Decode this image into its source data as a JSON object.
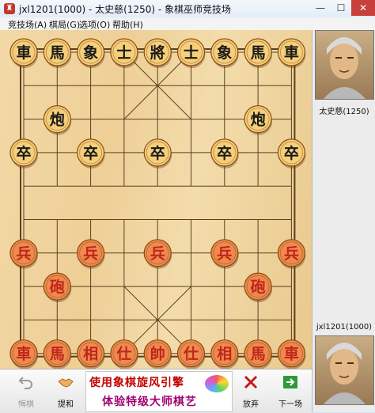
{
  "window": {
    "title": "jxl1201(1000) - 太史慈(1250) - 象棋巫师竞技场",
    "minimize_glyph": "—",
    "maximize_glyph": "☐",
    "close_glyph": "✕"
  },
  "menu": [
    {
      "label": "竞技场(A)"
    },
    {
      "label": "棋局(G)"
    },
    {
      "label": "选项(O)"
    },
    {
      "label": "帮助(H)"
    }
  ],
  "players": {
    "opponent": {
      "name": "太史慈(1250)"
    },
    "self": {
      "name": "jxl1201(1000)"
    }
  },
  "toolbar": {
    "undo_label": "悔棋",
    "draw_label": "提和",
    "resign_label": "放弃",
    "next_label": "下一场"
  },
  "ad": {
    "line1": "使用象棋旋风引擎",
    "line2": "体验特级大师棋艺"
  },
  "board_colors": {
    "black_piece_text": "#1a1a1a",
    "red_piece_text": "#c0261b",
    "black_piece_face": "#f5cf7a",
    "red_piece_face": "#ee8a4e",
    "line": "#5a4020"
  },
  "pieces": [
    {
      "col": 0,
      "row": 0,
      "side": "black",
      "label": "車",
      "name": "black-chariot"
    },
    {
      "col": 1,
      "row": 0,
      "side": "black",
      "label": "馬",
      "name": "black-horse"
    },
    {
      "col": 2,
      "row": 0,
      "side": "black",
      "label": "象",
      "name": "black-elephant"
    },
    {
      "col": 3,
      "row": 0,
      "side": "black",
      "label": "士",
      "name": "black-advisor"
    },
    {
      "col": 4,
      "row": 0,
      "side": "black",
      "label": "將",
      "name": "black-general"
    },
    {
      "col": 5,
      "row": 0,
      "side": "black",
      "label": "士",
      "name": "black-advisor"
    },
    {
      "col": 6,
      "row": 0,
      "side": "black",
      "label": "象",
      "name": "black-elephant"
    },
    {
      "col": 7,
      "row": 0,
      "side": "black",
      "label": "馬",
      "name": "black-horse"
    },
    {
      "col": 8,
      "row": 0,
      "side": "black",
      "label": "車",
      "name": "black-chariot"
    },
    {
      "col": 1,
      "row": 2,
      "side": "black",
      "label": "炮",
      "name": "black-cannon"
    },
    {
      "col": 7,
      "row": 2,
      "side": "black",
      "label": "炮",
      "name": "black-cannon"
    },
    {
      "col": 0,
      "row": 3,
      "side": "black",
      "label": "卒",
      "name": "black-soldier"
    },
    {
      "col": 2,
      "row": 3,
      "side": "black",
      "label": "卒",
      "name": "black-soldier"
    },
    {
      "col": 4,
      "row": 3,
      "side": "black",
      "label": "卒",
      "name": "black-soldier"
    },
    {
      "col": 6,
      "row": 3,
      "side": "black",
      "label": "卒",
      "name": "black-soldier"
    },
    {
      "col": 8,
      "row": 3,
      "side": "black",
      "label": "卒",
      "name": "black-soldier"
    },
    {
      "col": 0,
      "row": 6,
      "side": "red",
      "label": "兵",
      "name": "red-soldier"
    },
    {
      "col": 2,
      "row": 6,
      "side": "red",
      "label": "兵",
      "name": "red-soldier"
    },
    {
      "col": 4,
      "row": 6,
      "side": "red",
      "label": "兵",
      "name": "red-soldier"
    },
    {
      "col": 6,
      "row": 6,
      "side": "red",
      "label": "兵",
      "name": "red-soldier"
    },
    {
      "col": 8,
      "row": 6,
      "side": "red",
      "label": "兵",
      "name": "red-soldier"
    },
    {
      "col": 1,
      "row": 7,
      "side": "red",
      "label": "砲",
      "name": "red-cannon"
    },
    {
      "col": 7,
      "row": 7,
      "side": "red",
      "label": "砲",
      "name": "red-cannon"
    },
    {
      "col": 0,
      "row": 9,
      "side": "red",
      "label": "車",
      "name": "red-chariot"
    },
    {
      "col": 1,
      "row": 9,
      "side": "red",
      "label": "馬",
      "name": "red-horse"
    },
    {
      "col": 2,
      "row": 9,
      "side": "red",
      "label": "相",
      "name": "red-elephant"
    },
    {
      "col": 3,
      "row": 9,
      "side": "red",
      "label": "仕",
      "name": "red-advisor"
    },
    {
      "col": 4,
      "row": 9,
      "side": "red",
      "label": "帥",
      "name": "red-general"
    },
    {
      "col": 5,
      "row": 9,
      "side": "red",
      "label": "仕",
      "name": "red-advisor"
    },
    {
      "col": 6,
      "row": 9,
      "side": "red",
      "label": "相",
      "name": "red-elephant"
    },
    {
      "col": 7,
      "row": 9,
      "side": "red",
      "label": "馬",
      "name": "red-horse"
    },
    {
      "col": 8,
      "row": 9,
      "side": "red",
      "label": "車",
      "name": "red-chariot"
    }
  ]
}
